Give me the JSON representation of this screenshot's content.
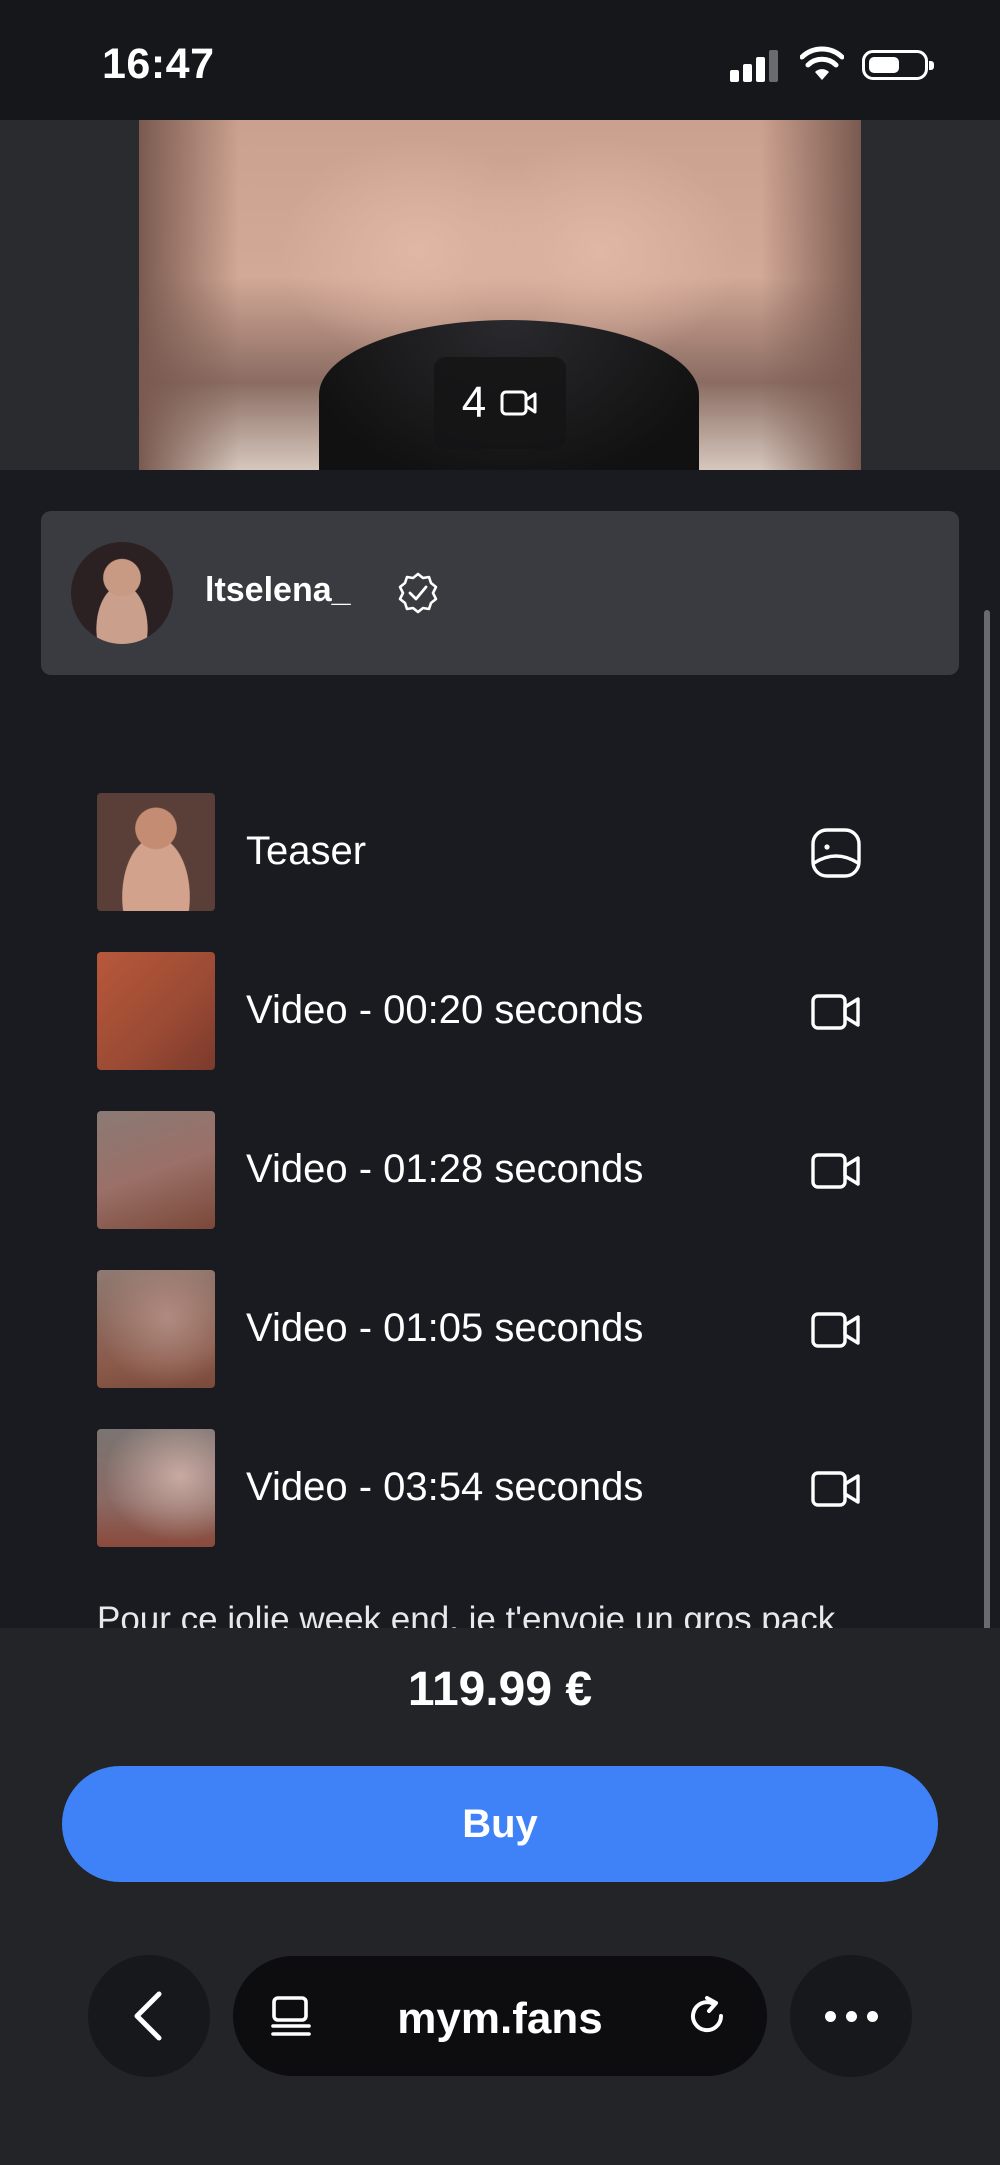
{
  "status_bar": {
    "time": "16:47"
  },
  "media_preview": {
    "count": "4"
  },
  "creator": {
    "name": "ltselena_"
  },
  "items": [
    {
      "label": "Teaser",
      "icon": "teaser-icon"
    },
    {
      "label": "Video - 00:20 seconds",
      "icon": "video-camera-icon"
    },
    {
      "label": "Video - 01:28 seconds",
      "icon": "video-camera-icon"
    },
    {
      "label": "Video - 01:05 seconds",
      "icon": "video-camera-icon"
    },
    {
      "label": "Video - 03:54 seconds",
      "icon": "video-camera-icon"
    }
  ],
  "description": "Pour ce jolie week end, je t'envoie un gros pack",
  "purchase": {
    "price": "119.99 €",
    "buy_label": "Buy"
  },
  "browser": {
    "url": "mym.fans"
  },
  "colors": {
    "accent": "#3f82f7",
    "background": "#1a1b20"
  }
}
